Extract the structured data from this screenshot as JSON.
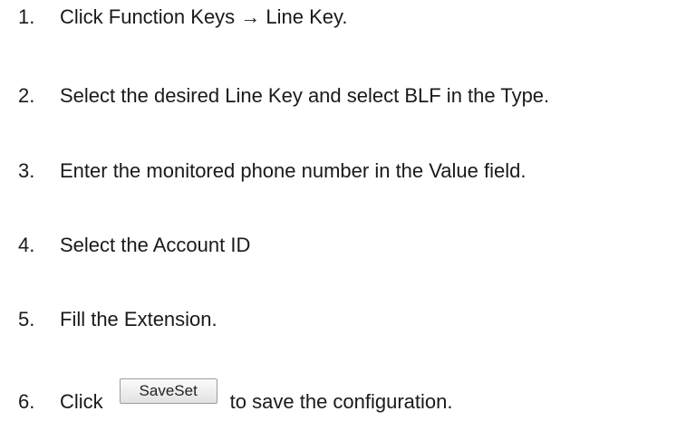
{
  "steps": [
    {
      "number": "1.",
      "text": "Click Function Keys → Line Key."
    },
    {
      "number": "2.",
      "text": "Select the desired Line Key and select BLF in the Type."
    },
    {
      "number": "3.",
      "text": "Enter the monitored phone number in the Value field."
    },
    {
      "number": "4.",
      "text": "Select the Account ID"
    },
    {
      "number": "5.",
      "text": "Fill the Extension."
    },
    {
      "number": "6.",
      "before": "Click",
      "button_label": "SaveSet",
      "after": "to save the configuration."
    }
  ]
}
